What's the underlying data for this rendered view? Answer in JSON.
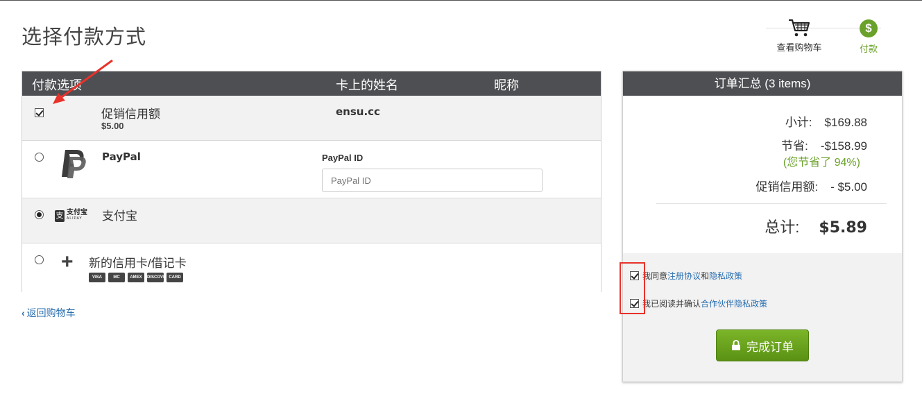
{
  "page": {
    "title": "选择付款方式"
  },
  "steps": {
    "cart_label": "查看购物车",
    "pay_label": "付款",
    "pay_symbol": "$",
    "accent_color": "#6aa12a"
  },
  "payment_table": {
    "headers": {
      "option": "付款选项",
      "name_on_card": "卡上的姓名",
      "nickname": "昵称"
    },
    "credit": {
      "label": "促销信用额",
      "amount": "$5.00",
      "name": "ensu.cc",
      "checked": true
    },
    "paypal": {
      "label": "PayPal",
      "field_label": "PayPal ID",
      "placeholder": "PayPal ID",
      "selected": false
    },
    "alipay": {
      "label": "支付宝",
      "logo_cn": "支付宝",
      "logo_en": "ALIPAY",
      "logo_mark": "支",
      "selected": true
    },
    "card": {
      "label": "新的信用卡/借记卡",
      "brands": [
        "VISA",
        "MC",
        "AMEX",
        "DISCOVER",
        "CARD"
      ],
      "selected": false
    }
  },
  "back_link": {
    "label": "返回购物车"
  },
  "summary": {
    "title": "订单汇总 (3 items)",
    "subtotal_label": "小计:",
    "subtotal_value": "$169.88",
    "saving_label": "节省:",
    "saving_value": "-$158.99",
    "saving_note": "(您节省了 94%)",
    "credit_label": "促销信用额:",
    "credit_value": "- $5.00",
    "total_label": "总计:",
    "total_value": "$5.89",
    "agree1_prefix": "我同意",
    "agree1_link1": "注册协议",
    "agree1_and": "和",
    "agree1_link2": "隐私政策",
    "agree2_prefix": "我已阅读并确认",
    "agree2_link": "合作伙伴隐私政策",
    "complete_label": "完成订单",
    "button_color": "#6aa12a"
  }
}
